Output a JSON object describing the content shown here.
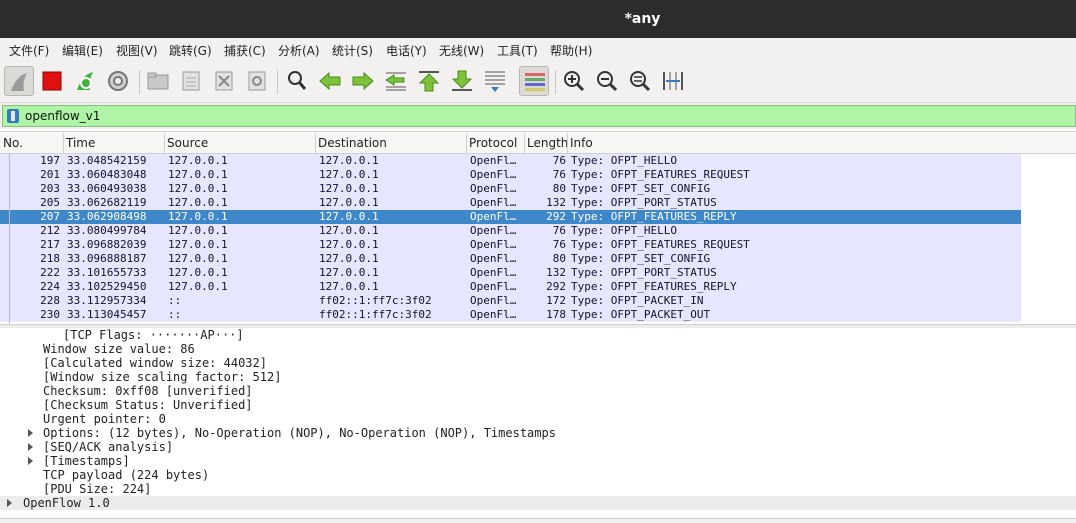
{
  "window": {
    "title": "*any"
  },
  "menu": [
    "文件(F)",
    "编辑(E)",
    "视图(V)",
    "跳转(G)",
    "捕获(C)",
    "分析(A)",
    "统计(S)",
    "电话(Y)",
    "无线(W)",
    "工具(T)",
    "帮助(H)"
  ],
  "toolbar": {
    "icons": [
      "shark-fin-icon",
      "stop-capture-icon",
      "restart-capture-icon",
      "capture-options-icon",
      "open-file-icon",
      "save-file-icon",
      "close-file-icon",
      "reload-file-icon",
      "find-packet-icon",
      "go-back-icon",
      "go-forward-icon",
      "go-to-packet-icon",
      "go-first-icon",
      "go-last-icon",
      "auto-scroll-icon",
      "colorize-icon",
      "zoom-in-icon",
      "zoom-out-icon",
      "zoom-normal-icon",
      "resize-columns-icon"
    ]
  },
  "filter": {
    "value": "openflow_v1",
    "color": "#aff5a6"
  },
  "columns": [
    "No.",
    "Time",
    "Source",
    "Destination",
    "Protocol",
    "Length",
    "Info"
  ],
  "packets": [
    {
      "no": "197",
      "time": "33.048542159",
      "src": "127.0.0.1",
      "dst": "127.0.0.1",
      "proto": "OpenFl…",
      "len": "76",
      "info": "Type: OFPT_HELLO"
    },
    {
      "no": "201",
      "time": "33.060483048",
      "src": "127.0.0.1",
      "dst": "127.0.0.1",
      "proto": "OpenFl…",
      "len": "76",
      "info": "Type: OFPT_FEATURES_REQUEST"
    },
    {
      "no": "203",
      "time": "33.060493038",
      "src": "127.0.0.1",
      "dst": "127.0.0.1",
      "proto": "OpenFl…",
      "len": "80",
      "info": "Type: OFPT_SET_CONFIG"
    },
    {
      "no": "205",
      "time": "33.062682119",
      "src": "127.0.0.1",
      "dst": "127.0.0.1",
      "proto": "OpenFl…",
      "len": "132",
      "info": "Type: OFPT_PORT_STATUS"
    },
    {
      "no": "207",
      "time": "33.062908498",
      "src": "127.0.0.1",
      "dst": "127.0.0.1",
      "proto": "OpenFl…",
      "len": "292",
      "info": "Type: OFPT_FEATURES_REPLY",
      "selected": true
    },
    {
      "no": "212",
      "time": "33.080499784",
      "src": "127.0.0.1",
      "dst": "127.0.0.1",
      "proto": "OpenFl…",
      "len": "76",
      "info": "Type: OFPT_HELLO"
    },
    {
      "no": "217",
      "time": "33.096882039",
      "src": "127.0.0.1",
      "dst": "127.0.0.1",
      "proto": "OpenFl…",
      "len": "76",
      "info": "Type: OFPT_FEATURES_REQUEST"
    },
    {
      "no": "218",
      "time": "33.096888187",
      "src": "127.0.0.1",
      "dst": "127.0.0.1",
      "proto": "OpenFl…",
      "len": "80",
      "info": "Type: OFPT_SET_CONFIG"
    },
    {
      "no": "222",
      "time": "33.101655733",
      "src": "127.0.0.1",
      "dst": "127.0.0.1",
      "proto": "OpenFl…",
      "len": "132",
      "info": "Type: OFPT_PORT_STATUS"
    },
    {
      "no": "224",
      "time": "33.102529450",
      "src": "127.0.0.1",
      "dst": "127.0.0.1",
      "proto": "OpenFl…",
      "len": "292",
      "info": "Type: OFPT_FEATURES_REPLY"
    },
    {
      "no": "228",
      "time": "33.112957334",
      "src": "::",
      "dst": "ff02::1:ff7c:3f02",
      "proto": "OpenFl…",
      "len": "172",
      "info": "Type: OFPT_PACKET_IN"
    },
    {
      "no": "230",
      "time": "33.113045457",
      "src": "::",
      "dst": "ff02::1:ff7c:3f02",
      "proto": "OpenFl…",
      "len": "178",
      "info": "Type: OFPT_PACKET_OUT"
    }
  ],
  "details": [
    {
      "text": "[TCP Flags: ·······AP···]",
      "indent": 2,
      "expandable": false
    },
    {
      "text": "Window size value: 86",
      "indent": 1,
      "expandable": false
    },
    {
      "text": "[Calculated window size: 44032]",
      "indent": 1,
      "expandable": false
    },
    {
      "text": "[Window size scaling factor: 512]",
      "indent": 1,
      "expandable": false
    },
    {
      "text": "Checksum: 0xff08 [unverified]",
      "indent": 1,
      "expandable": false
    },
    {
      "text": "[Checksum Status: Unverified]",
      "indent": 1,
      "expandable": false
    },
    {
      "text": "Urgent pointer: 0",
      "indent": 1,
      "expandable": false
    },
    {
      "text": "Options: (12 bytes), No-Operation (NOP), No-Operation (NOP), Timestamps",
      "indent": 1,
      "expandable": true
    },
    {
      "text": "[SEQ/ACK analysis]",
      "indent": 1,
      "expandable": true
    },
    {
      "text": "[Timestamps]",
      "indent": 1,
      "expandable": true
    },
    {
      "text": "TCP payload (224 bytes)",
      "indent": 1,
      "expandable": false
    },
    {
      "text": "[PDU Size: 224]",
      "indent": 1,
      "expandable": false
    },
    {
      "text": "OpenFlow 1.0",
      "indent": 0,
      "expandable": true,
      "highlight": true
    }
  ],
  "colors": {
    "row": "#e7e6ff",
    "selected": "#3e87c8",
    "titlebar": "#2c2c2c"
  }
}
